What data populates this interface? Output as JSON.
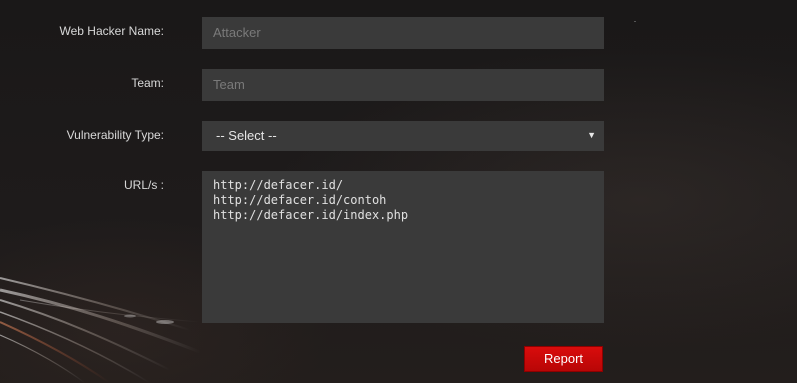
{
  "form": {
    "hacker_name": {
      "label": "Web Hacker Name:",
      "placeholder": "Attacker",
      "value": ""
    },
    "team": {
      "label": "Team:",
      "placeholder": "Team",
      "value": ""
    },
    "vulnerability_type": {
      "label": "Vulnerability Type:",
      "selected": "-- Select --"
    },
    "urls": {
      "label": "URL/s :",
      "value": "http://defacer.id/\nhttp://defacer.id/contoh\nhttp://defacer.id/index.php"
    },
    "submit_label": "Report"
  },
  "colors": {
    "accent": "#cc0a0a",
    "field_bg": "#3a3a3a",
    "page_bg": "#1c1a1a"
  }
}
